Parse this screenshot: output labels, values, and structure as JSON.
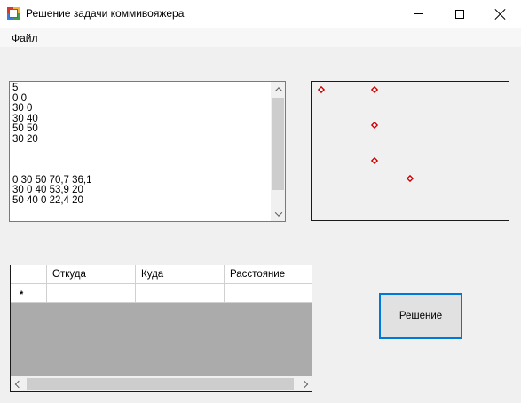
{
  "window": {
    "title": "Решение задачи коммивояжера",
    "icon": "app-icon",
    "controls": [
      "minimize-icon",
      "maximize-icon",
      "close-icon"
    ]
  },
  "menu": {
    "file_label": "Файл"
  },
  "input_text": {
    "lines": [
      "5",
      "0 0",
      "30 0",
      "30 40",
      "50 50",
      "30 20",
      "",
      "",
      "",
      "0 30 50 70,7 36,1",
      "30 0 40 53,9 20",
      "50 40 0 22,4 20"
    ]
  },
  "plot": {
    "point_color": "#d00000",
    "points": [
      [
        0,
        0
      ],
      [
        30,
        0
      ],
      [
        30,
        20
      ],
      [
        30,
        40
      ],
      [
        50,
        50
      ]
    ]
  },
  "grid": {
    "columns": [
      "Откуда",
      "Куда",
      "Расстояние"
    ],
    "new_row_marker": "*"
  },
  "buttons": {
    "solve_label": "Решение"
  }
}
